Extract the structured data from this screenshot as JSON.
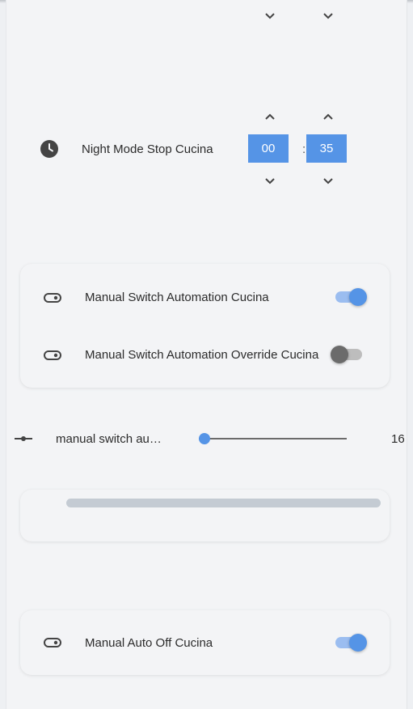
{
  "night_mode_stop": {
    "label": "Night Mode Stop Cucina",
    "hours": "00",
    "minutes": "35",
    "separator": ":",
    "icon": "clock-icon"
  },
  "switch_card": {
    "items": [
      {
        "label": "Manual Switch Automation Cucina",
        "state": "on",
        "icon": "toggle-switch-icon"
      },
      {
        "label": "Manual Switch Automation Override Cucina",
        "state": "off",
        "icon": "toggle-switch-icon"
      }
    ]
  },
  "slider": {
    "label": "manual switch au…",
    "value": "16",
    "icon": "slider-icon"
  },
  "auto_off_card": {
    "label": "Manual Auto Off Cucina",
    "state": "on",
    "icon": "toggle-switch-icon"
  },
  "colors": {
    "accent": "#5594e6",
    "accent_light": "#9bbdf0",
    "toggle_off_knob": "#6b6b6b",
    "background": "#f3f4f6"
  }
}
